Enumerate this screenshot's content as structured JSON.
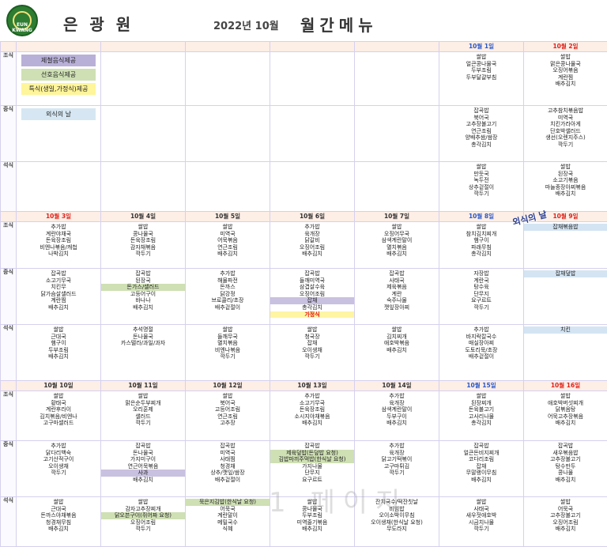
{
  "header": {
    "org_name": "은 광 원",
    "logo_text": "EUN KWANG",
    "month": "2022년 10월",
    "title": "월간메뉴"
  },
  "meals": [
    "조식",
    "중식",
    "석식"
  ],
  "legend": [
    "제철음식제공",
    "선호음식제공",
    "특식(생일,가정식)제공",
    "외식의 날"
  ],
  "stamp": "외식의 날",
  "watermark": "1 페이지",
  "weeks": [
    {
      "dates": [
        "",
        "",
        "",
        "",
        "",
        "10월 1일",
        "10월 2일"
      ],
      "rows": [
        [
          [],
          [],
          [],
          [],
          [],
          [
            "쌀밥",
            "얼큰콩나물국",
            "두부조림",
            "두부달걀부침"
          ],
          [
            "쌀밥",
            "맑은콩나물국",
            "오징어볶음",
            "계란찜",
            "배추김치"
          ]
        ],
        [
          [],
          [],
          [],
          [],
          [],
          [
            "잡곡밥",
            "북어국",
            "고추장불고기",
            "연근조림",
            "양배추쌈/쌈장",
            "총각김치"
          ],
          [
            "고추참치볶음밥",
            "미역국",
            "치킨가라아게",
            "단호박샐러드",
            "생선(오렌지주스)",
            "깍두기"
          ]
        ],
        [
          [],
          [],
          [],
          [],
          [],
          [
            "쌀밥",
            "만둣국",
            "녹두전",
            "상추겉절이",
            "깍두기"
          ],
          [
            "쌀밥",
            "된장국",
            "소고기볶음",
            "마늘종장아찌볶음",
            "배추김치"
          ]
        ]
      ]
    },
    {
      "dates": [
        "10월 3일",
        "10월 4일",
        "10월 5일",
        "10월 6일",
        "10월 7일",
        "10월 8일",
        "10월 9일"
      ],
      "rows": [
        [
          [
            "추가밥",
            "계란야채국",
            "돈육장조림",
            "비엔나볶음/캐첩",
            "나박김치"
          ],
          [
            "쌀밥",
            "콩나물국",
            "돈육장조림",
            "감자채볶음",
            "깍두기"
          ],
          [
            "쌀밥",
            "미역국",
            "어묵볶음",
            "연근조림",
            "배추김치"
          ],
          [
            "추가밥",
            "육개장",
            "닭갈비",
            "오징어조림",
            "배추김치"
          ],
          [
            "쌀밥",
            "오징어무국",
            "삼색계란말이",
            "멸치볶음",
            "배추김치"
          ],
          [
            "쌀밥",
            "참치김치찌개",
            "햄구이",
            "파래무침",
            "총각김치"
          ],
          [
            "",
            "",
            "",
            "",
            "잡채볶음밥"
          ]
        ],
        [
          [
            "잡곡밥",
            "소고기무국",
            "치킨무",
            "닭가슴살샐러드",
            "계란찜",
            "배추김치"
          ],
          [
            "잡곡밥",
            "된장국",
            {
              "t": "돈가스/샐러드",
              "c": "green"
            },
            "고등어구이",
            "바나나",
            "배추김치"
          ],
          [
            "추가밥",
            "해물파전",
            "돈까스",
            "닭강정",
            "브로콜리/초장",
            "배추겉절이"
          ],
          [
            "잡곡밥",
            "들깨미역국",
            "삼겹살수육",
            "오징어조림",
            {
              "t": "잡채",
              "c": "purple"
            },
            "총각김치",
            {
              "t": "가정식",
              "c": "yellow"
            }
          ],
          [
            "잡곡밥",
            "사태국",
            "제육볶음",
            "계란",
            "숙주나물",
            "깻잎장아찌"
          ],
          [
            "자장밥",
            "계란국",
            "탕수육",
            "단무지",
            "요구르트",
            "깍두기"
          ],
          [
            "",
            "",
            "",
            "",
            "잡채덮밥"
          ]
        ],
        [
          [
            "쌀밥",
            "근대국",
            "햄구이",
            "두부조림",
            "배추김치"
          ],
          [
            "추석명절",
            "돈나물국",
            "카스텔라/과일/과자"
          ],
          [
            "쌀밥",
            "들깨무국",
            "멸치볶음",
            "비엔나볶음",
            "깍두기"
          ],
          [
            "쌀밥",
            "청국장",
            "잡채",
            "오이생채",
            "깍두기"
          ],
          [
            "쌀밥",
            "김치찌개",
            "애호박볶음",
            "배추김치"
          ],
          [
            "추가밥",
            "바지락칼국수",
            "매실장아찌",
            "도토리묵/초장",
            "배추겉절이"
          ],
          [
            "",
            "",
            "",
            "",
            "치킨"
          ]
        ]
      ]
    },
    {
      "dates": [
        "10월 10일",
        "10월 11일",
        "10월 12일",
        "10월 13일",
        "10월 14일",
        "10월 15일",
        "10월 16일"
      ],
      "rows": [
        [
          [
            "쌀밥",
            "황태국",
            "계란후라이",
            "김치볶음/비엔나",
            "고구마샐러드"
          ],
          [
            "쌀밥",
            "맑은순두부찌개",
            "오리훈제",
            "샐러드",
            "깍두기"
          ],
          [
            "쌀밥",
            "북어국",
            "고등어조림",
            "연근조림",
            "고추장"
          ],
          [
            "추가밥",
            "소고기무국",
            "돈육장조림",
            "소시지야채볶음",
            "배추김치"
          ],
          [
            "추가밥",
            "육개장",
            "삼색계란말이",
            "두부구이",
            "배추김치"
          ],
          [
            "쌀밥",
            "된장찌개",
            "돈육불고기",
            "고사리나물",
            "총각김치"
          ],
          [
            "쌀밥",
            "애호박버섯찌개",
            "닭볶음탕",
            "어묵고추장볶음",
            "배추김치"
          ]
        ],
        [
          [
            "추가밥",
            "닭다리백숙",
            "고기산적구이",
            "오이생채",
            "깍두기"
          ],
          [
            "잡곡밥",
            "돈나물국",
            "가지미구이",
            "연근어묵볶음",
            {
              "t": "사과",
              "c": "purple"
            },
            "배추김치"
          ],
          [
            "잡곡밥",
            "미역국",
            "사태찜",
            "청경채",
            "상추/깻잎/쌈장",
            "배추겉절이"
          ],
          [
            "잡곡밥",
            {
              "t": "제육덮밥(돈덮밥 요청)",
              "c": "green"
            },
            {
              "t": "김밥마끼주먹밥(한식날 요청)",
              "c": "green"
            },
            "가지나물",
            "단무지",
            "요구르트"
          ],
          [
            "추가밥",
            "육개장",
            "닭고기떡볶이",
            "고구마튀김",
            "깍두기"
          ],
          [
            "잡곡밥",
            "얼큰돈비지찌개",
            "코다리조림",
            "잡채",
            "무말랭이무침",
            "배추김치"
          ],
          [
            "잡곡밥",
            "새우볶음밥",
            "고추장불고기",
            "탕수만두",
            "콩나물",
            "배추김치"
          ]
        ],
        [
          [
            "쌀밥",
            "근대국",
            "돈까스야채볶음",
            "청경채무침",
            "배추김치"
          ],
          [
            "쌀밥",
            "감자고추장찌개",
            {
              "t": "닭오븐구이(쥐어짜 요청)",
              "c": "green"
            },
            "오징어조림",
            "깍두기"
          ],
          [
            {
              "t": "묵은지김밥(한식날 요청)",
              "c": "green"
            },
            "어묵국",
            "계란말이",
            "메밀국수",
            "식혜"
          ],
          [
            "쌀밥",
            "콩나물국",
            "두부조림",
            "미역줄기볶음",
            "배추김치"
          ],
          [
            {
              "t": "잔치국수/떡잔칫날",
              "c": ""
            },
            "비빔밥",
            "오이소박이무침",
            "오이생채(한식날 요청)",
            "무도라지"
          ],
          [
            "쌀밥",
            "사태국",
            "새우젓애호박",
            "시금치나물",
            "깍두기"
          ],
          [
            "쌀밥",
            "어묵국",
            "고추장불고기",
            "오징어조림",
            "배추김치"
          ]
        ]
      ]
    }
  ]
}
